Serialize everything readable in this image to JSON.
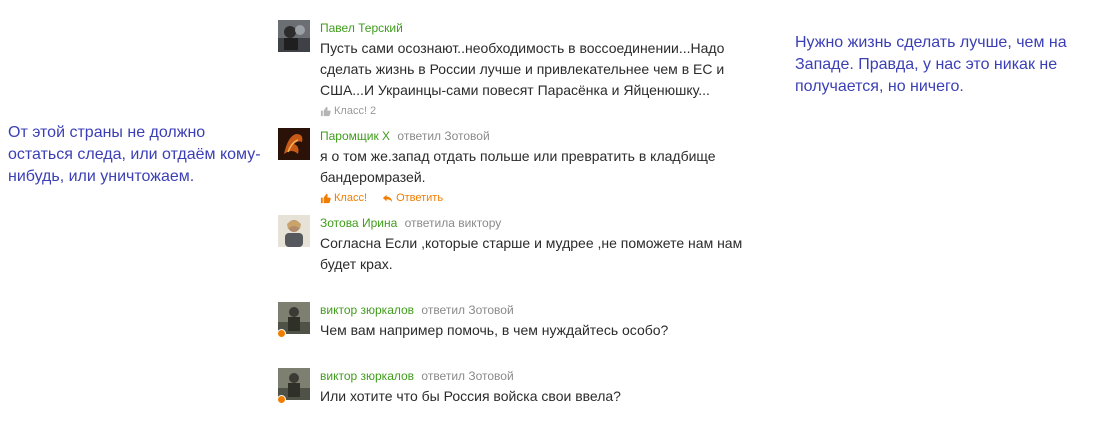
{
  "notes": {
    "left": "От этой страны не должно остаться следа, или отдаём кому-нибудь, или уничтожаем.",
    "right": "Нужно жизнь сделать лучше, чем на Западе. Правда, у нас это никак не получается, но ничего."
  },
  "comments": [
    {
      "author": "Павел Терский",
      "replied": "",
      "text": "Пусть сами осознают..необходимость в воссоединении...Надо сделать жизнь в России лучше и привлекательнее чем в ЕС и США...И Украинцы-сами повесят Парасёнка и Яйценюшку...",
      "klass": "Класс! 2"
    },
    {
      "author": "Паромщик Х",
      "replied": "ответил Зотовой",
      "text": "я о том же.запад отдать польше или превратить в кладбище бандеромразей.",
      "klass": "Класс!",
      "reply": "Ответить"
    },
    {
      "author": "Зотова Ирина",
      "replied": "ответила виктору",
      "text": "Согласна Если ,которые старше и мудрее ,не поможете нам нам будет крах."
    },
    {
      "author": "виктор зюркалов",
      "replied": "ответил Зотовой",
      "text": "Чем вам например помочь, в чем нуждайтесь особо?"
    },
    {
      "author": "виктор зюркалов",
      "replied": "ответил Зотовой",
      "text": "Или хотите что бы Россия войска свои ввела?"
    }
  ],
  "colors": {
    "author": "#3f9c1b",
    "note": "#3b3fb5",
    "action_orange": "#f07d00",
    "muted": "#8a8a8a"
  }
}
